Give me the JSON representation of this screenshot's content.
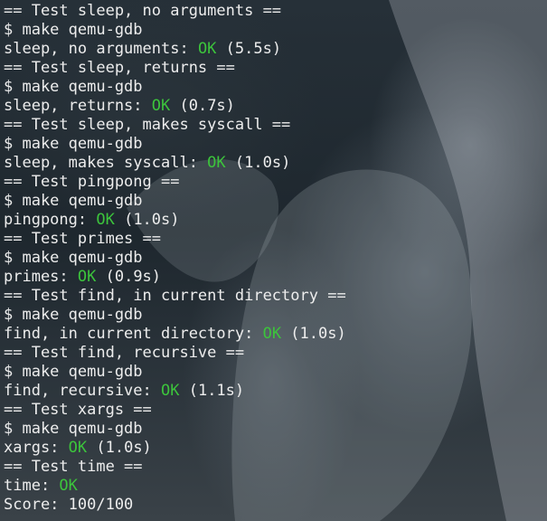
{
  "terminal": {
    "lines": [
      {
        "kind": "header",
        "text": "== Test sleep, no arguments =="
      },
      {
        "kind": "cmd",
        "text": "$ make qemu-gdb"
      },
      {
        "kind": "result",
        "label": "sleep, no arguments: ",
        "status": "OK",
        "time": " (5.5s)"
      },
      {
        "kind": "header",
        "text": "== Test sleep, returns =="
      },
      {
        "kind": "cmd",
        "text": "$ make qemu-gdb"
      },
      {
        "kind": "result",
        "label": "sleep, returns: ",
        "status": "OK",
        "time": " (0.7s)"
      },
      {
        "kind": "header",
        "text": "== Test sleep, makes syscall =="
      },
      {
        "kind": "cmd",
        "text": "$ make qemu-gdb"
      },
      {
        "kind": "result",
        "label": "sleep, makes syscall: ",
        "status": "OK",
        "time": " (1.0s)"
      },
      {
        "kind": "header",
        "text": "== Test pingpong =="
      },
      {
        "kind": "cmd",
        "text": "$ make qemu-gdb"
      },
      {
        "kind": "result",
        "label": "pingpong: ",
        "status": "OK",
        "time": " (1.0s)"
      },
      {
        "kind": "header",
        "text": "== Test primes =="
      },
      {
        "kind": "cmd",
        "text": "$ make qemu-gdb"
      },
      {
        "kind": "result",
        "label": "primes: ",
        "status": "OK",
        "time": " (0.9s)"
      },
      {
        "kind": "header",
        "text": "== Test find, in current directory =="
      },
      {
        "kind": "cmd",
        "text": "$ make qemu-gdb"
      },
      {
        "kind": "result",
        "label": "find, in current directory: ",
        "status": "OK",
        "time": " (1.0s)"
      },
      {
        "kind": "header",
        "text": "== Test find, recursive =="
      },
      {
        "kind": "cmd",
        "text": "$ make qemu-gdb"
      },
      {
        "kind": "result",
        "label": "find, recursive: ",
        "status": "OK",
        "time": " (1.1s)"
      },
      {
        "kind": "header",
        "text": "== Test xargs =="
      },
      {
        "kind": "cmd",
        "text": "$ make qemu-gdb"
      },
      {
        "kind": "result",
        "label": "xargs: ",
        "status": "OK",
        "time": " (1.0s)"
      },
      {
        "kind": "header",
        "text": "== Test time =="
      },
      {
        "kind": "result",
        "label": "time: ",
        "status": "OK",
        "time": ""
      },
      {
        "kind": "plain",
        "text": "Score: 100/100"
      }
    ],
    "colors": {
      "text": "#ededed",
      "ok": "#3cc43c",
      "prompt": "#4aa3d6"
    }
  }
}
